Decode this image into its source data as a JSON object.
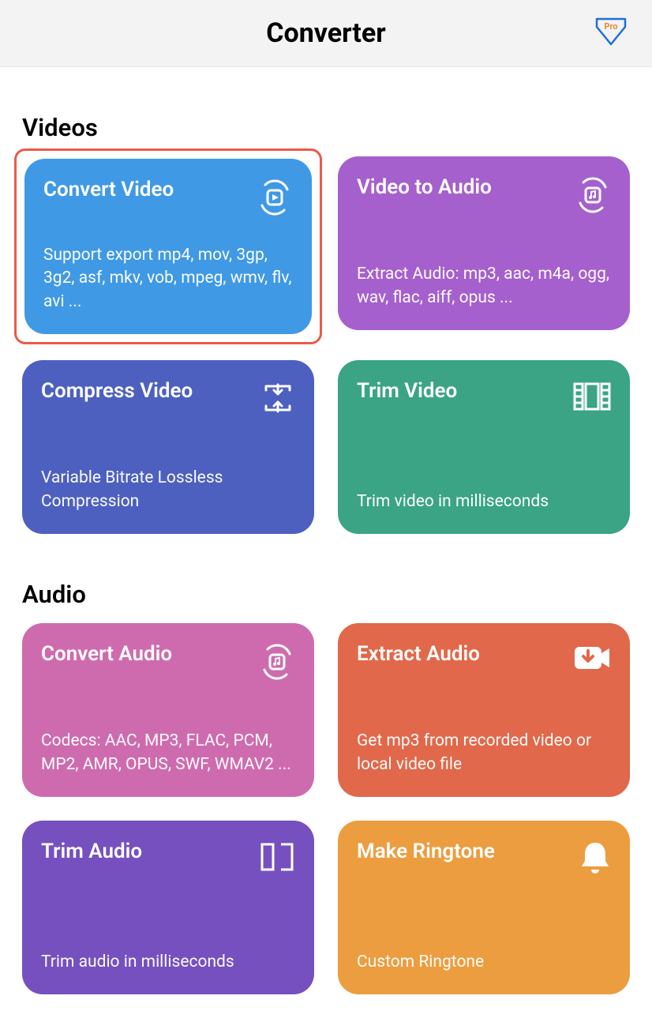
{
  "header": {
    "title": "Converter",
    "pro_label": "Pro"
  },
  "sections": [
    {
      "title": "Videos",
      "cards": [
        {
          "title": "Convert Video",
          "desc": "Support export mp4, mov, 3gp, 3g2, asf, mkv, vob, mpeg, wmv, flv, avi ...",
          "color": "c-blue",
          "icon": "convert-video-icon",
          "highlight": true
        },
        {
          "title": "Video to Audio",
          "desc": "Extract Audio: mp3, aac, m4a, ogg, wav, flac, aiff, opus ...",
          "color": "c-purple",
          "icon": "video-to-audio-icon"
        },
        {
          "title": "Compress Video",
          "desc": "Variable Bitrate Lossless Compression",
          "color": "c-indigo",
          "icon": "compress-icon"
        },
        {
          "title": "Trim Video",
          "desc": "Trim video in milliseconds",
          "color": "c-teal",
          "icon": "film-trim-icon"
        }
      ]
    },
    {
      "title": "Audio",
      "cards": [
        {
          "title": "Convert Audio",
          "desc": "Codecs: AAC, MP3, FLAC, PCM, MP2, AMR, OPUS, SWF, WMAV2 ...",
          "color": "c-pink",
          "icon": "convert-audio-icon"
        },
        {
          "title": "Extract Audio",
          "desc": "Get mp3 from recorded video or local video file",
          "color": "c-orange",
          "icon": "camera-download-icon"
        },
        {
          "title": "Trim Audio",
          "desc": "Trim audio in milliseconds",
          "color": "c-violet",
          "icon": "trim-audio-icon"
        },
        {
          "title": "Make Ringtone",
          "desc": "Custom Ringtone",
          "color": "c-amber",
          "icon": "bell-icon"
        }
      ]
    }
  ]
}
